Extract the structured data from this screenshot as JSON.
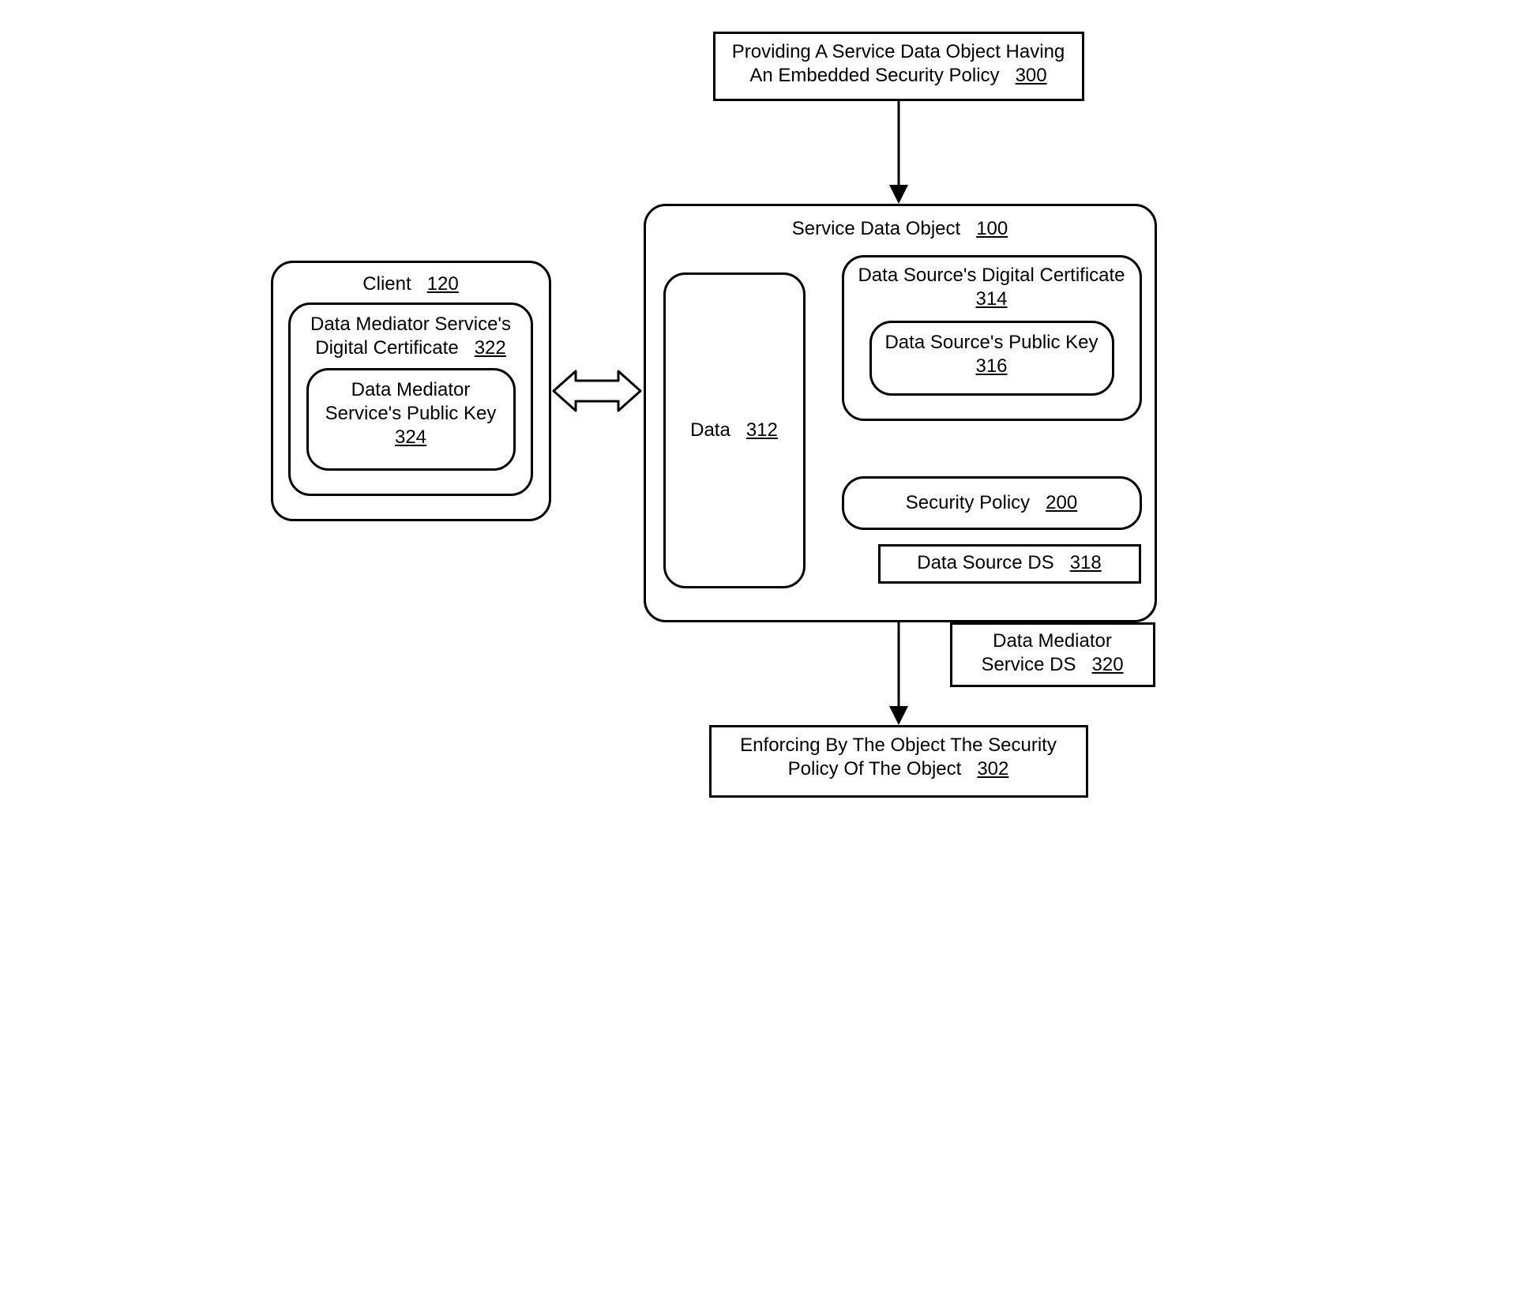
{
  "top_box": {
    "line1": "Providing A Service Data Object Having",
    "line2": "An Embedded Security Policy",
    "ref": "300"
  },
  "client": {
    "title": "Client",
    "title_ref": "120",
    "cert": {
      "line1": "Data Mediator Service's",
      "line2": "Digital Certificate",
      "ref": "322",
      "key": {
        "line1": "Data Mediator",
        "line2": "Service's Public Key",
        "ref": "324"
      }
    }
  },
  "sdo": {
    "title": "Service Data Object",
    "title_ref": "100",
    "data": {
      "label": "Data",
      "ref": "312"
    },
    "cert": {
      "label": "Data Source's Digital Certificate",
      "ref": "314",
      "key": {
        "label": "Data Source's Public Key",
        "ref": "316"
      }
    },
    "policy": {
      "label": "Security Policy",
      "ref": "200"
    },
    "ds_source": {
      "label": "Data Source DS",
      "ref": "318"
    },
    "ds_mediator": {
      "line1": "Data Mediator",
      "line2": "Service DS",
      "ref": "320"
    }
  },
  "bottom_box": {
    "line1": "Enforcing By The Object The Security",
    "line2": "Policy Of The Object",
    "ref": "302"
  }
}
